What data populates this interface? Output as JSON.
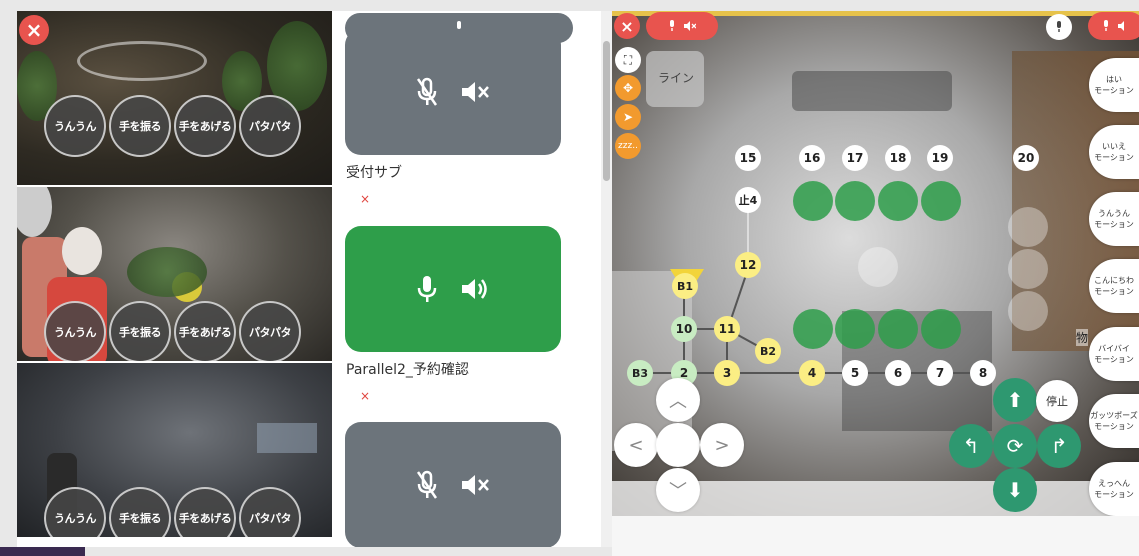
{
  "left_panel": {
    "motion_buttons": [
      "うんうん",
      "手を振る",
      "手をあげる",
      "パタパタ"
    ],
    "close_label": "×"
  },
  "middle_panel": {
    "tiles": [
      {
        "label": "受付サブ",
        "status": "muted"
      },
      {
        "label": "Parallel2_予約確認",
        "status": "active"
      },
      {
        "label": "",
        "status": "muted"
      }
    ],
    "remove_label": "×"
  },
  "right_panel": {
    "close_label": "×",
    "line_label": "ライン",
    "zzz_label": "zzz..",
    "stop_label": "停止",
    "object_label": "物",
    "map_nodes": [
      "15",
      "16",
      "17",
      "18",
      "19",
      "20",
      "止4",
      "12",
      "B1",
      "10",
      "11",
      "B2",
      "B3",
      "2",
      "3",
      "4",
      "5",
      "6",
      "7",
      "8"
    ],
    "motions": [
      {
        "name": "はい",
        "sub": "モーション"
      },
      {
        "name": "いいえ",
        "sub": "モーション"
      },
      {
        "name": "うんうん",
        "sub": "モーション"
      },
      {
        "name": "こんにちわ",
        "sub": "モーション"
      },
      {
        "name": "バイバイ",
        "sub": "モーション"
      },
      {
        "name": "ガッツポーズ",
        "sub": "モーション"
      },
      {
        "name": "えっへん",
        "sub": "モーション"
      }
    ]
  },
  "colors": {
    "accent_red": "#e8544e",
    "accent_green": "#2e9e4a",
    "tile_gray": "#6c747b",
    "orange": "#f29a2e",
    "teal": "#2e9870"
  }
}
